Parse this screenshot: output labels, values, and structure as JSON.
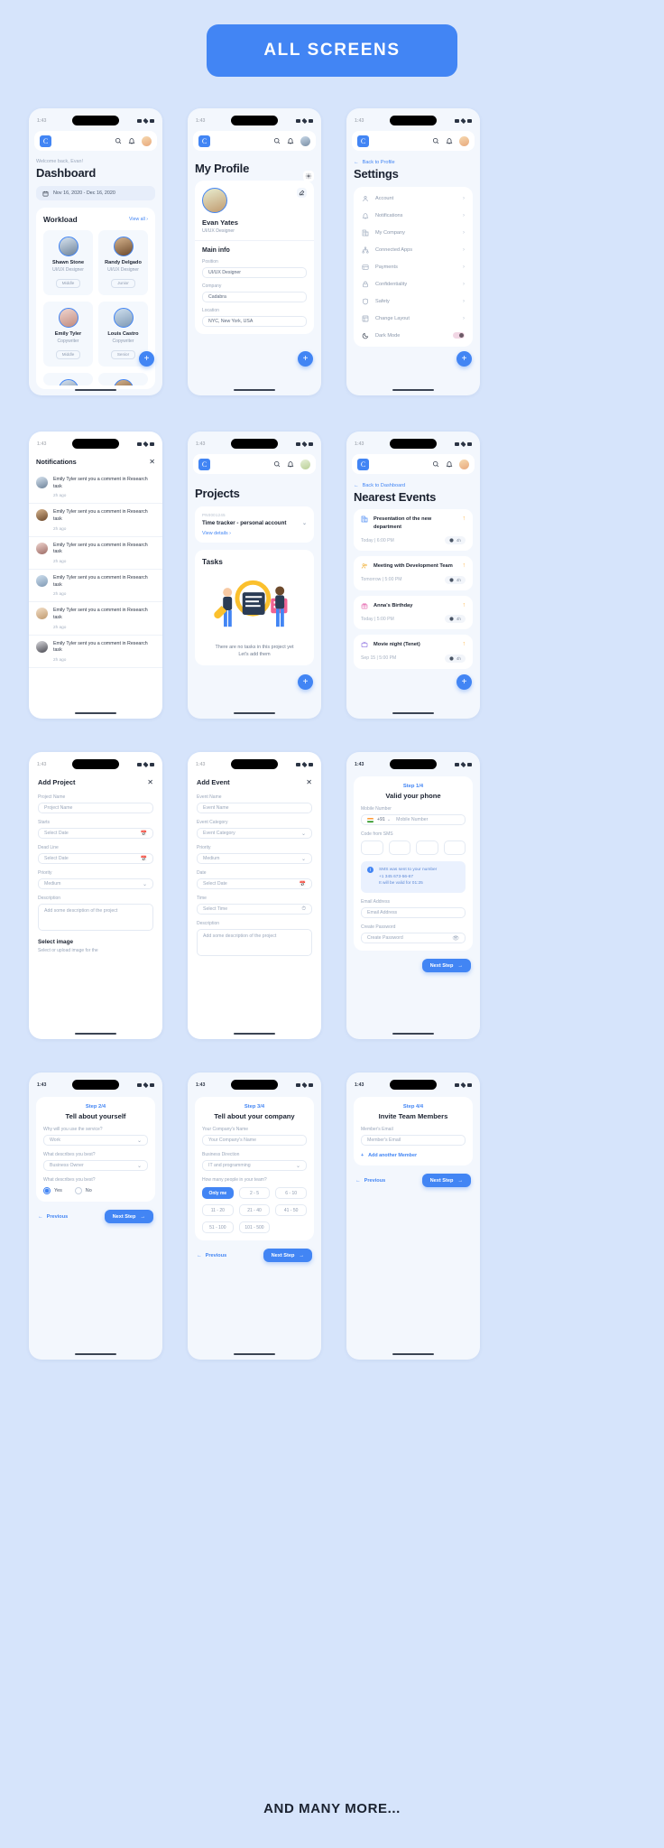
{
  "banner": {
    "label": "ALL SCREENS"
  },
  "footer": {
    "label": "AND MANY MORE..."
  },
  "statusbar": {
    "time": "1:43"
  },
  "appbar": {
    "logo": "C"
  },
  "dashboard": {
    "welcome": "Welcome back, Evan!",
    "title": "Dashboard",
    "date_range": "Nov 16, 2020 - Dec 16, 2020",
    "workload_title": "Workload",
    "view_all": "View all  ›",
    "members": [
      {
        "name": "Shawn Stone",
        "role": "UI/UX Designer",
        "level": "Middle"
      },
      {
        "name": "Randy Delgado",
        "role": "UI/UX Designer",
        "level": "Junior"
      },
      {
        "name": "Emily Tyler",
        "role": "Copywriter",
        "level": "Middle"
      },
      {
        "name": "Louis Castro",
        "role": "Copywriter",
        "level": "Senior"
      }
    ]
  },
  "profile": {
    "title": "My Profile",
    "name": "Evan Yates",
    "role": "UI/UX Designer",
    "section": "Main info",
    "fields": [
      {
        "label": "Position",
        "value": "UI/UX Designer"
      },
      {
        "label": "Company",
        "value": "Cadabra"
      },
      {
        "label": "Location",
        "value": "NYC, New York, USA"
      }
    ]
  },
  "settings": {
    "back": "Back to Profile",
    "title": "Settings",
    "items": [
      {
        "label": "Account",
        "icon": "user-icon"
      },
      {
        "label": "Notifications",
        "icon": "bell-icon"
      },
      {
        "label": "My Company",
        "icon": "building-icon"
      },
      {
        "label": "Connected Apps",
        "icon": "apps-icon"
      },
      {
        "label": "Payments",
        "icon": "card-icon"
      },
      {
        "label": "Confidentiality",
        "icon": "lock-icon"
      },
      {
        "label": "Safety",
        "icon": "shield-icon"
      },
      {
        "label": "Change Layout",
        "icon": "layout-icon"
      },
      {
        "label": "Dark Mode",
        "icon": "moon-icon"
      }
    ]
  },
  "notifications": {
    "title": "Notifications",
    "items": [
      {
        "text": "Emily Tyler sent you a comment in Research task",
        "time": "2h ago"
      },
      {
        "text": "Emily Tyler sent you a comment in Research task",
        "time": "2h ago"
      },
      {
        "text": "Emily Tyler sent you a comment in Research task",
        "time": "2h ago"
      },
      {
        "text": "Emily Tyler sent you a comment in Research task",
        "time": "2h ago"
      },
      {
        "text": "Emily Tyler sent you a comment in Research task",
        "time": "2h ago"
      },
      {
        "text": "Emily Tyler sent you a comment in Research task",
        "time": "2h ago"
      }
    ]
  },
  "projects": {
    "title": "Projects",
    "project_id": "PN0001245",
    "project_name": "Time tracker - personal account",
    "view_details": "View details  ›",
    "tasks_title": "Tasks",
    "empty_text": "There are no tasks in this project yet Let's add them"
  },
  "events": {
    "back": "Back to Dashboard",
    "title": "Nearest Events",
    "items": [
      {
        "name": "Presentation of the new department",
        "time": "Today | 6:00 PM",
        "badge": "4h",
        "icon": "building-icon"
      },
      {
        "name": "Meeting with Development Team",
        "time": "Tomorrow | 5:00 PM",
        "badge": "4h",
        "icon": "people-icon"
      },
      {
        "name": "Anna's Birthday",
        "time": "Today | 5:00 PM",
        "badge": "4h",
        "icon": "gift-icon"
      },
      {
        "name": "Movie night (Tenet)",
        "time": "Sep 15 | 5:00 PM",
        "badge": "4h",
        "icon": "tv-icon"
      }
    ]
  },
  "add_project": {
    "title": "Add Project",
    "fields": [
      {
        "label": "Project Name",
        "placeholder": "Project Name",
        "right": ""
      },
      {
        "label": "Starts",
        "placeholder": "Select Date",
        "right": "calendar-icon"
      },
      {
        "label": "Dead Line",
        "placeholder": "Select Date",
        "right": "calendar-icon"
      },
      {
        "label": "Priority",
        "placeholder": "Medium",
        "right": "chevron-down-icon"
      },
      {
        "label": "Description",
        "placeholder": "Add some description of the project",
        "right": ""
      }
    ],
    "select_image_title": "Select image",
    "select_image_sub": "Select or upload image for the"
  },
  "add_event": {
    "title": "Add Event",
    "fields": [
      {
        "label": "Event Name",
        "placeholder": "Event Name",
        "right": ""
      },
      {
        "label": "Event Category",
        "placeholder": "Event Category",
        "right": "chevron-down-icon"
      },
      {
        "label": "Priority",
        "placeholder": "Medium",
        "right": "chevron-down-icon"
      },
      {
        "label": "Date",
        "placeholder": "Select Date",
        "right": "calendar-icon"
      },
      {
        "label": "Time",
        "placeholder": "Select Time",
        "right": "clock-icon"
      },
      {
        "label": "Description",
        "placeholder": "Add some description of the project",
        "right": ""
      }
    ]
  },
  "step1": {
    "step": "Step 1/4",
    "title": "Valid your phone",
    "mobile_label": "Mobile Number",
    "mobile_code": "+91",
    "mobile_placeholder": "Mobile Number",
    "sms_label": "Code from SMS",
    "info_line1": "SMS was sent to your number",
    "info_line2": "+1 345 673-56-67",
    "info_line3": "It will be valid for 01:25",
    "email_label": "Email Address",
    "email_placeholder": "Email Address",
    "password_label": "Create Password",
    "password_placeholder": "Create Password",
    "next": "Next Step"
  },
  "step2": {
    "step": "Step 2/4",
    "title": "Tell about yourself",
    "q1": "Why will you use the service?",
    "a1": "Work",
    "q2": "What describes you best?",
    "a2": "Business Owner",
    "q3": "What describes you best?",
    "opt_yes": "Yes",
    "opt_no": "No",
    "prev": "Previous",
    "next": "Next Step"
  },
  "step3": {
    "step": "Step 3/4",
    "title": "Tell about your company",
    "q1": "Your Company's Name",
    "a1": "Your Company's Name",
    "q2": "Business Direction",
    "a2": "IT and programming",
    "q3": "How many people in your team?",
    "sizes": [
      "Only me",
      "2 - 5",
      "6 - 10",
      "11 - 20",
      "21 - 40",
      "41 - 50",
      "51 - 100",
      "101 - 500"
    ],
    "selected_size": "Only me",
    "prev": "Previous",
    "next": "Next Step"
  },
  "step4": {
    "step": "Step 4/4",
    "title": "Invite Team Members",
    "label": "Member's Email",
    "placeholder": "Member's Email",
    "add_another": "Add another Member",
    "prev": "Previous",
    "next": "Next Step"
  },
  "colors": {
    "accent": "#4285f4",
    "bg": "#d6e4fb",
    "panel": "#f3f7fd"
  }
}
